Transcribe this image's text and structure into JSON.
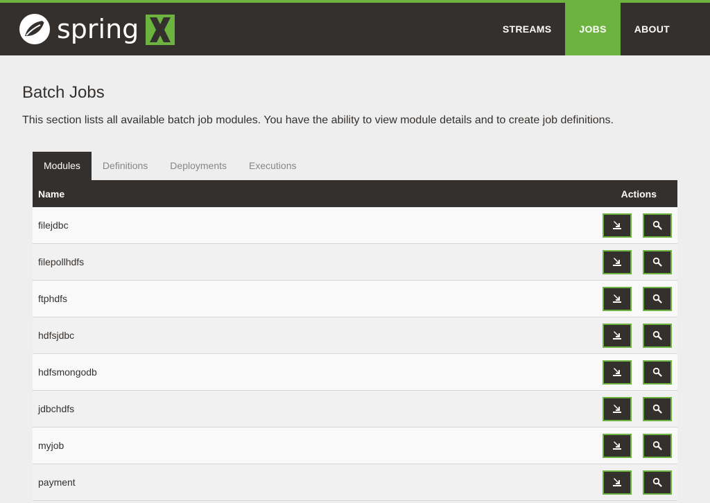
{
  "header": {
    "brand": "spring",
    "nav": [
      {
        "label": "STREAMS",
        "active": false
      },
      {
        "label": "JOBS",
        "active": true
      },
      {
        "label": "ABOUT",
        "active": false
      }
    ]
  },
  "page": {
    "title": "Batch Jobs",
    "description": "This section lists all available batch job modules. You have the ability to view module details and to create job definitions."
  },
  "tabs": [
    {
      "label": "Modules",
      "active": true
    },
    {
      "label": "Definitions",
      "active": false
    },
    {
      "label": "Deployments",
      "active": false
    },
    {
      "label": "Executions",
      "active": false
    }
  ],
  "table": {
    "columns": {
      "name": "Name",
      "actions": "Actions"
    },
    "rows": [
      "filejdbc",
      "filepollhdfs",
      "ftphdfs",
      "hdfsjdbc",
      "hdfsmongodb",
      "jdbchdfs",
      "myjob",
      "payment"
    ]
  },
  "icons": {
    "create": "create-definition-icon",
    "details": "search-icon"
  },
  "colors": {
    "accent": "#6db33f",
    "dark": "#34302d",
    "background": "#eeeeee"
  }
}
